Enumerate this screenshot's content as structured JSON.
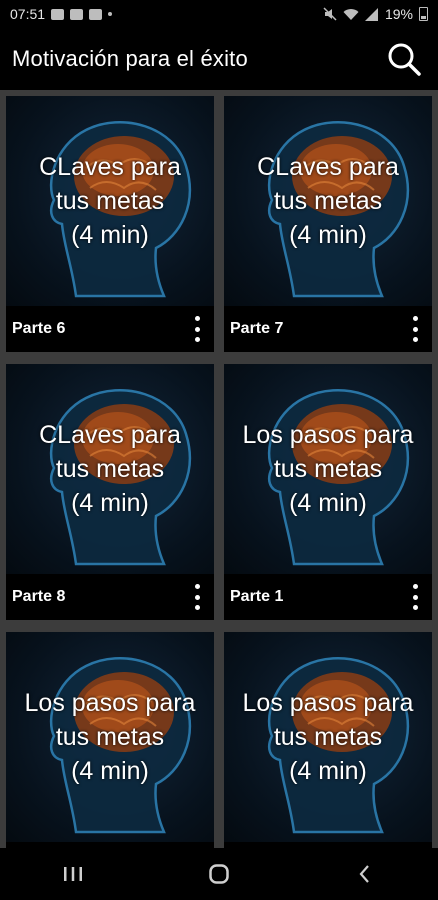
{
  "status_bar": {
    "time": "07:51",
    "battery": "19%"
  },
  "app_bar": {
    "title": "Motivación para el éxito",
    "search_icon": "search-icon"
  },
  "cards": [
    {
      "line1": "CLaves para",
      "line2": "tus metas",
      "line3": "(4 min)",
      "part": "Parte 6"
    },
    {
      "line1": "CLaves para",
      "line2": "tus metas",
      "line3": "(4 min)",
      "part": "Parte 7"
    },
    {
      "line1": "CLaves para",
      "line2": "tus metas",
      "line3": "(4 min)",
      "part": "Parte 8"
    },
    {
      "line1": "Los pasos para",
      "line2": "tus metas",
      "line3": "(4 min)",
      "part": "Parte 1"
    },
    {
      "line1": "Los pasos para",
      "line2": "tus metas",
      "line3": "(4 min)",
      "part": ""
    },
    {
      "line1": "Los pasos para",
      "line2": "tus metas",
      "line3": "(4 min)",
      "part": ""
    }
  ],
  "nav_bar": {
    "icons": [
      "recent-apps-icon",
      "home-icon",
      "back-icon"
    ]
  }
}
